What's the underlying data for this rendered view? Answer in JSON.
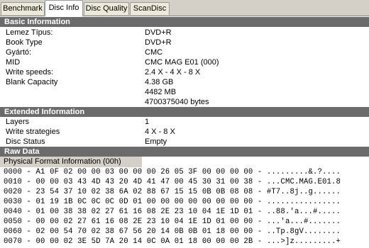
{
  "tabs": [
    {
      "label": "Benchmark",
      "active": false
    },
    {
      "label": "Disc Info",
      "active": true
    },
    {
      "label": "Disc Quality",
      "active": false
    },
    {
      "label": "ScanDisc",
      "active": false
    }
  ],
  "basic": {
    "title": "Basic Information",
    "rows": [
      {
        "label": "Lemez Típus:",
        "value": "DVD+R"
      },
      {
        "label": "Book Type",
        "value": "DVD+R"
      },
      {
        "label": "Gyártó:",
        "value": "CMC"
      },
      {
        "label": "MID",
        "value": "CMC MAG E01 (000)"
      },
      {
        "label": "Write speeds:",
        "value": "2.4 X - 4 X - 8 X"
      },
      {
        "label": "Blank Capacity",
        "value": "4.38 GB"
      },
      {
        "label": "",
        "value": "4482 MB"
      },
      {
        "label": "",
        "value": "4700375040 bytes"
      }
    ]
  },
  "extended": {
    "title": "Extended Information",
    "rows": [
      {
        "label": "Layers",
        "value": "1"
      },
      {
        "label": "Write strategies",
        "value": "4 X - 8 X"
      },
      {
        "label": "Disc Status",
        "value": "Empty"
      }
    ]
  },
  "raw": {
    "title": "Raw Data",
    "subheader": "Physical Format Information (00h)",
    "lines": [
      "0000 - A1 0F 02 00 00 03 00 00 00 26 05 3F 00 00 00 00 - .........&.?....",
      "0010 - 00 00 03 43 4D 43 20 4D 41 47 00 45 30 31 00 38 - ...CMC.MAG.E01.8",
      "0020 - 23 54 37 10 02 38 6A 02 88 67 15 15 0B 0B 08 08 - #T7..8j..g......",
      "0030 - 01 19 1B 0C 0C 0C 0D 01 00 00 00 00 00 00 00 00 - ................",
      "0040 - 01 00 38 38 02 27 61 16 08 2E 23 10 04 1E 1D 01 - ..88.'a...#.....",
      "0050 - 00 00 02 27 61 16 08 2E 23 10 04 1E 1D 01 00 00 - ...'a...#.......",
      "0060 - 02 00 54 70 02 38 67 56 20 14 0B 0B 01 18 00 00 - ..Tp.8gV........",
      "0070 - 00 00 02 3E 5D 7A 20 14 0C 0A 01 18 00 00 00 2B - ...>]z.........+"
    ]
  }
}
